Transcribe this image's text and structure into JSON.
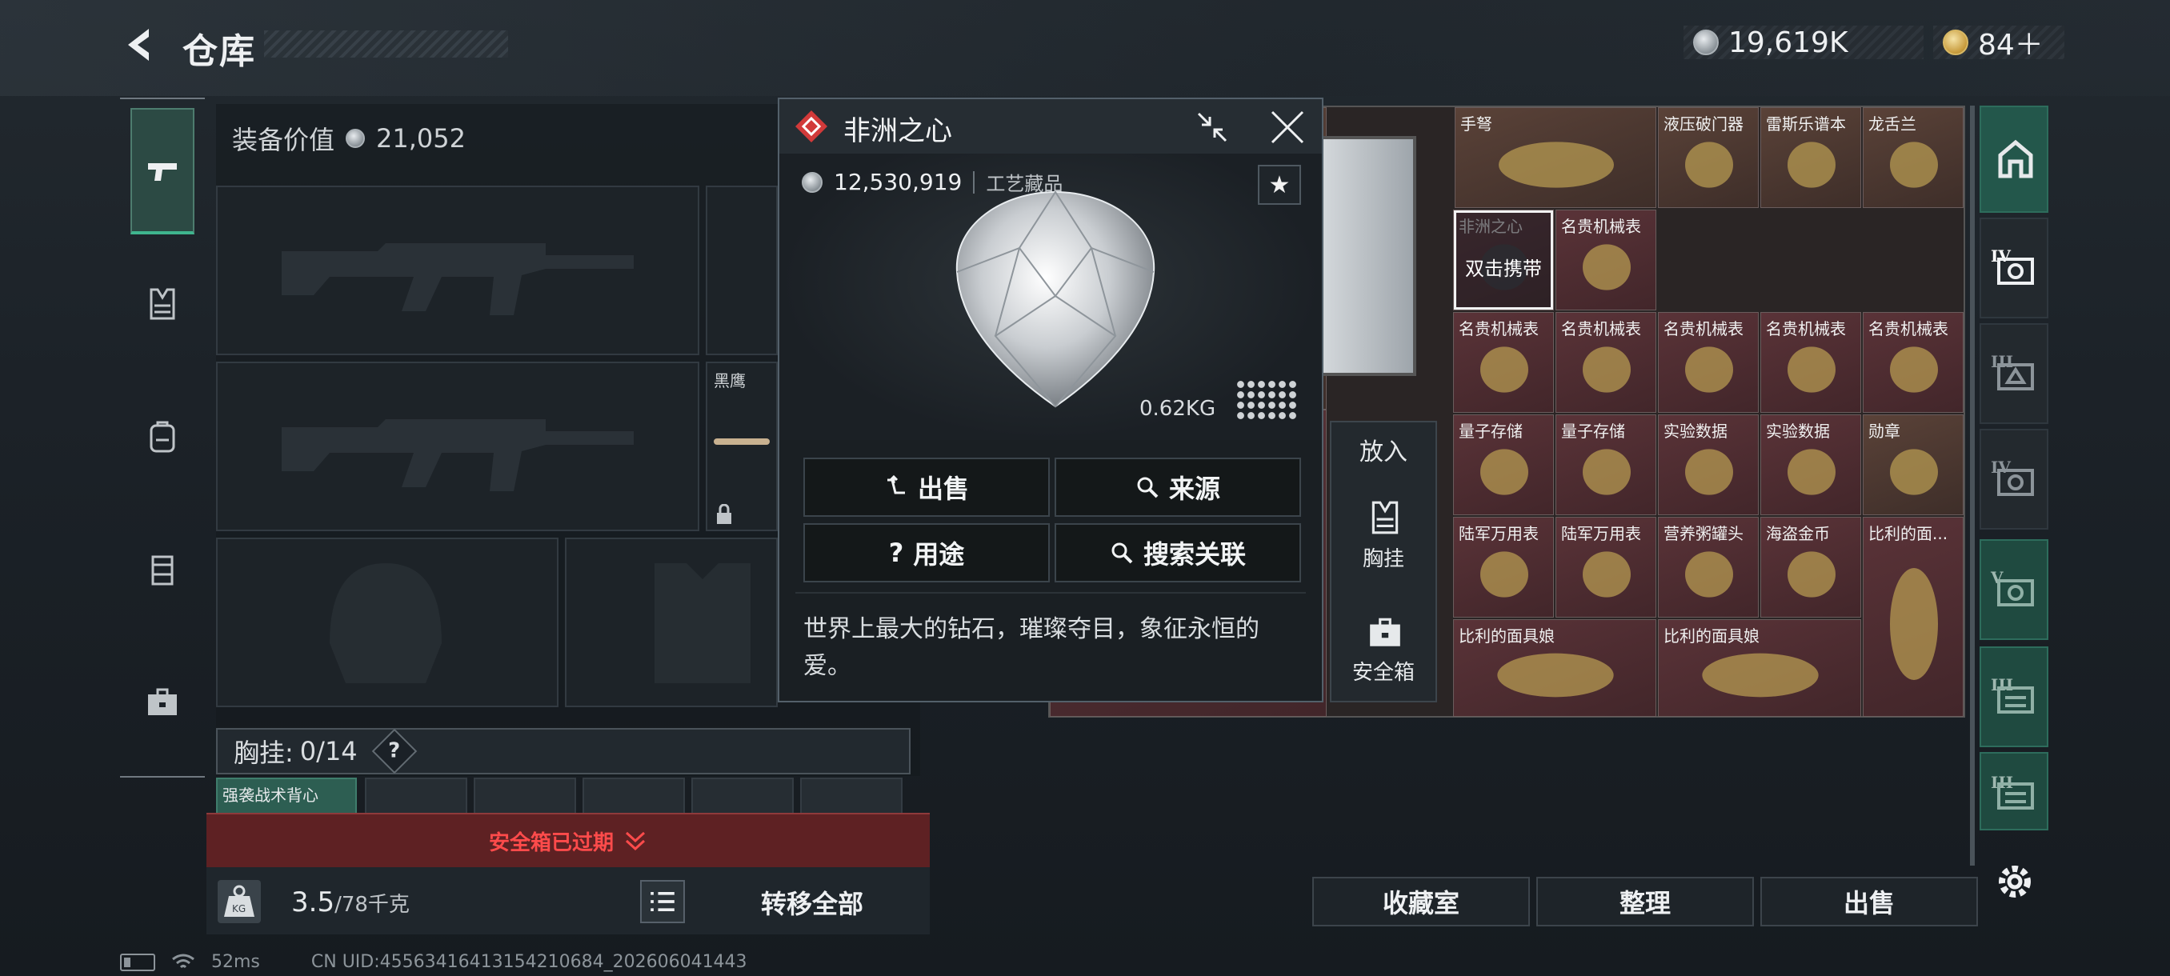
{
  "header": {
    "title": "仓库",
    "currency_silver": "19,619K",
    "currency_gold": "84＋"
  },
  "equipment": {
    "value_label": "装备价值",
    "value": "21,052",
    "slot_black_eagle": "黑鹰",
    "chest_rig_label": "胸挂:",
    "chest_rig_count": "0/14",
    "help_icon": "?",
    "small_slot_item": "强袭战术背心",
    "safebox_expired": "安全箱已过期",
    "weight_value": "3.5",
    "weight_unit": "/78千克",
    "transfer_all": "转移全部"
  },
  "popup": {
    "item_name": "非洲之心",
    "price": "12,530,919",
    "category": "工艺藏品",
    "weight": "0.62KG",
    "star": "★",
    "btn_sell": "出售",
    "btn_source": "来源",
    "btn_usage": "用途",
    "btn_search_related": "搜索关联",
    "usage_prefix": "?",
    "description": "世界上最大的钻石，璀璨夺目，象征永恒的爱。"
  },
  "put_panel": {
    "title": "放入",
    "chest_rig": "胸挂",
    "safebox": "安全箱"
  },
  "grid": {
    "items": [
      {
        "name": "手弩",
        "color": "brown"
      },
      {
        "name": "液压破门器",
        "color": "brown"
      },
      {
        "name": "雷斯乐谱本",
        "color": "brown"
      },
      {
        "name": "龙舌兰",
        "color": "brown"
      },
      {
        "name": "非洲之心",
        "color": "red"
      },
      {
        "name": "名贵机械表",
        "color": "red"
      },
      {
        "name": "名贵机械表",
        "color": "red"
      },
      {
        "name": "名贵机械表",
        "color": "red"
      },
      {
        "name": "名贵机械表",
        "color": "red"
      },
      {
        "name": "名贵机械表",
        "color": "red"
      },
      {
        "name": "名贵机械表",
        "color": "red"
      },
      {
        "name": "量子存储",
        "color": "red"
      },
      {
        "name": "量子存储",
        "color": "red"
      },
      {
        "name": "实验数据",
        "color": "red"
      },
      {
        "name": "实验数据",
        "color": "red"
      },
      {
        "name": "勋章",
        "color": "brown"
      },
      {
        "name": "陆军万用表",
        "color": "red"
      },
      {
        "name": "陆军万用表",
        "color": "red"
      },
      {
        "name": "营养粥罐头",
        "color": "red"
      },
      {
        "name": "海盗金币",
        "color": "red"
      },
      {
        "name": "比利的面...",
        "color": "red"
      },
      {
        "name": "比利的面具娘",
        "color": "red"
      },
      {
        "name": "比利的面具娘",
        "color": "red"
      }
    ],
    "double_tap_hint": "双击携带"
  },
  "bottom_buttons": {
    "collection": "收藏室",
    "organize": "整理",
    "sell": "出售"
  },
  "status_bar": {
    "ping": "52ms",
    "uid": "CN UID:4556341641315421068​4_202606041443"
  },
  "right_nav": [
    "IV",
    "III",
    "IV",
    "V",
    "III",
    "III"
  ]
}
